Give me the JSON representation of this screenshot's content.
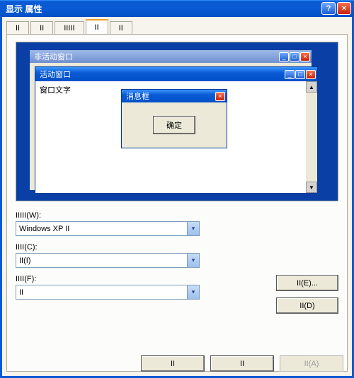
{
  "dialog": {
    "title": "显示 属性",
    "help_glyph": "?",
    "close_glyph": "×"
  },
  "tabs": [
    "II",
    "II",
    "IIIII",
    "II",
    "II"
  ],
  "selected_tab_index": 3,
  "preview": {
    "inactive_title": "非活动窗口",
    "active_title": "活动窗口",
    "window_text": "窗口文字",
    "msgbox_title": "消息框",
    "msgbox_ok": "确定",
    "scroll_up": "▲",
    "scroll_down": "▼",
    "mini_min": "_",
    "mini_max": "□",
    "mini_close": "×"
  },
  "form": {
    "style_label": "IIIII(W):",
    "style_value": "Windows XP II",
    "color_label": "IIII(C):",
    "color_value": "II(I)",
    "font_label": "IIII(F):",
    "font_value": "II",
    "effects_btn": "II(E)...",
    "advanced_btn": "II(D)"
  },
  "buttons": {
    "ok": "II",
    "cancel": "II",
    "apply": "II(A)"
  },
  "combo_arrow": "▾"
}
